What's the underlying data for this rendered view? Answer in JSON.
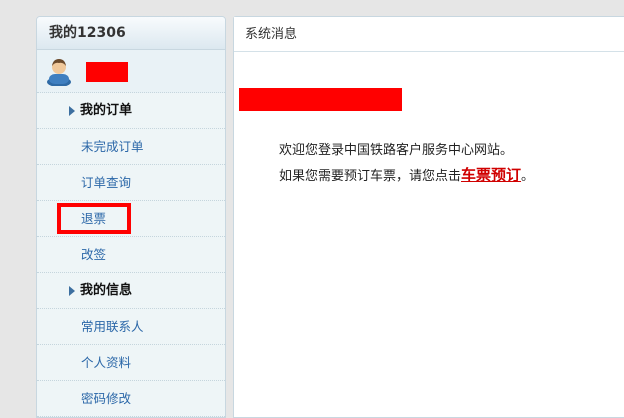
{
  "sidebar": {
    "title": "我的12306",
    "sections": [
      {
        "label": "我的订单",
        "items": [
          {
            "label": "未完成订单"
          },
          {
            "label": "订单查询"
          },
          {
            "label": "退票"
          },
          {
            "label": "改签"
          }
        ]
      },
      {
        "label": "我的信息",
        "items": [
          {
            "label": "常用联系人"
          },
          {
            "label": "个人资料"
          },
          {
            "label": "密码修改"
          }
        ]
      }
    ]
  },
  "main": {
    "title": "系统消息",
    "welcome_line1": "欢迎您登录中国铁路客户服务中心网站。",
    "welcome_line2_prefix": "如果您需要预订车票，请您点击",
    "book_link": "车票预订",
    "welcome_line2_suffix": "。"
  },
  "colors": {
    "redaction": "#ff0000",
    "link_blue": "#2b67a8",
    "book_link_red": "#d00000"
  },
  "icons": {
    "avatar": "user-avatar-icon",
    "section_arrow": "triangle-right-icon"
  }
}
